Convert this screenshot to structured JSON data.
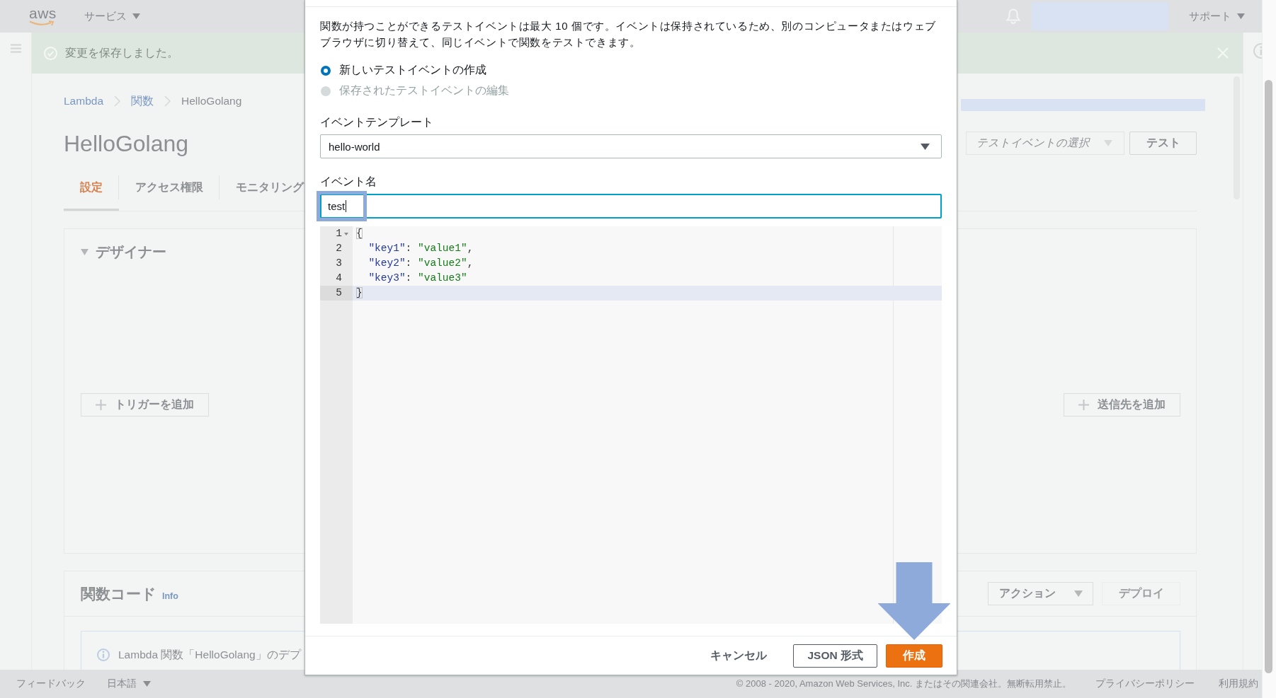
{
  "top_nav": {
    "logo": "aws",
    "services_menu": "サービス",
    "support_menu": "サポート"
  },
  "flash": {
    "message": "変更を保存しました。"
  },
  "breadcrumb": [
    {
      "label": "Lambda",
      "link": true
    },
    {
      "label": "関数",
      "link": true
    },
    {
      "label": "HelloGolang",
      "link": false
    }
  ],
  "page_title": "HelloGolang",
  "test_controls": {
    "event_select": {
      "placeholder": "テストイベントの選択"
    },
    "test_button": "テスト"
  },
  "tabs": [
    {
      "label": "設定",
      "selected": true
    },
    {
      "label": "アクセス権限",
      "selected": false
    },
    {
      "label": "モニタリング",
      "selected": false
    }
  ],
  "designer": {
    "title": "デザイナー",
    "expanded": true,
    "add_trigger_button": "トリガーを追加",
    "add_destination_button": "送信先を追加"
  },
  "function_code": {
    "title": "関数コード",
    "info_link": "Info",
    "actions_button": "アクション",
    "deploy_button": {
      "label": "デプロイ",
      "disabled": true
    },
    "notice": "Lambda 関数「HelloGolang」のデプ"
  },
  "dialog": {
    "description": "関数が持つことができるテストイベントは最大 10 個です。イベントは保持されているため、別のコンピュータまたはウェブブラウザに切り替えて、同じイベントで関数をテストできます。",
    "modes": [
      {
        "label": "新しいテストイベントの作成",
        "selected": true,
        "disabled": false
      },
      {
        "label": "保存されたテストイベントの編集",
        "selected": false,
        "disabled": true
      }
    ],
    "template": {
      "label": "イベントテンプレート",
      "value": "hello-world"
    },
    "event_name": {
      "label": "イベント名",
      "value": "test",
      "focused": true,
      "annotated": true
    },
    "editor": {
      "lines": [
        {
          "number": "1",
          "foldable": true,
          "active": false,
          "tokens": [
            {
              "kind": "matched-bracket",
              "text": "{"
            }
          ]
        },
        {
          "number": "2",
          "foldable": false,
          "active": false,
          "tokens": [
            {
              "kind": "key",
              "text": "  \"key1\""
            },
            {
              "kind": "punct",
              "text": ": "
            },
            {
              "kind": "string",
              "text": "\"value1\""
            },
            {
              "kind": "punct",
              "text": ","
            }
          ]
        },
        {
          "number": "3",
          "foldable": false,
          "active": false,
          "tokens": [
            {
              "kind": "key",
              "text": "  \"key2\""
            },
            {
              "kind": "punct",
              "text": ": "
            },
            {
              "kind": "string",
              "text": "\"value2\""
            },
            {
              "kind": "punct",
              "text": ","
            }
          ]
        },
        {
          "number": "4",
          "foldable": false,
          "active": false,
          "tokens": [
            {
              "kind": "key",
              "text": "  \"key3\""
            },
            {
              "kind": "punct",
              "text": ": "
            },
            {
              "kind": "string",
              "text": "\"value3\""
            }
          ]
        },
        {
          "number": "5",
          "foldable": false,
          "active": true,
          "tokens": [
            {
              "kind": "matched-bracket",
              "text": "}"
            }
          ]
        }
      ]
    },
    "buttons": [
      {
        "label": "キャンセル",
        "kind": "link",
        "annotated": false
      },
      {
        "label": "JSON 形式",
        "kind": "normal",
        "annotated": false
      },
      {
        "label": "作成",
        "kind": "primary",
        "annotated": true
      }
    ]
  },
  "footer": {
    "feedback": "フィードバック",
    "language": "日本語",
    "copyright": "© 2008 - 2020, Amazon Web Services, Inc. またはその関連会社。無断転用禁止。",
    "links": [
      "プライバシーポリシー",
      "利用規約"
    ]
  }
}
